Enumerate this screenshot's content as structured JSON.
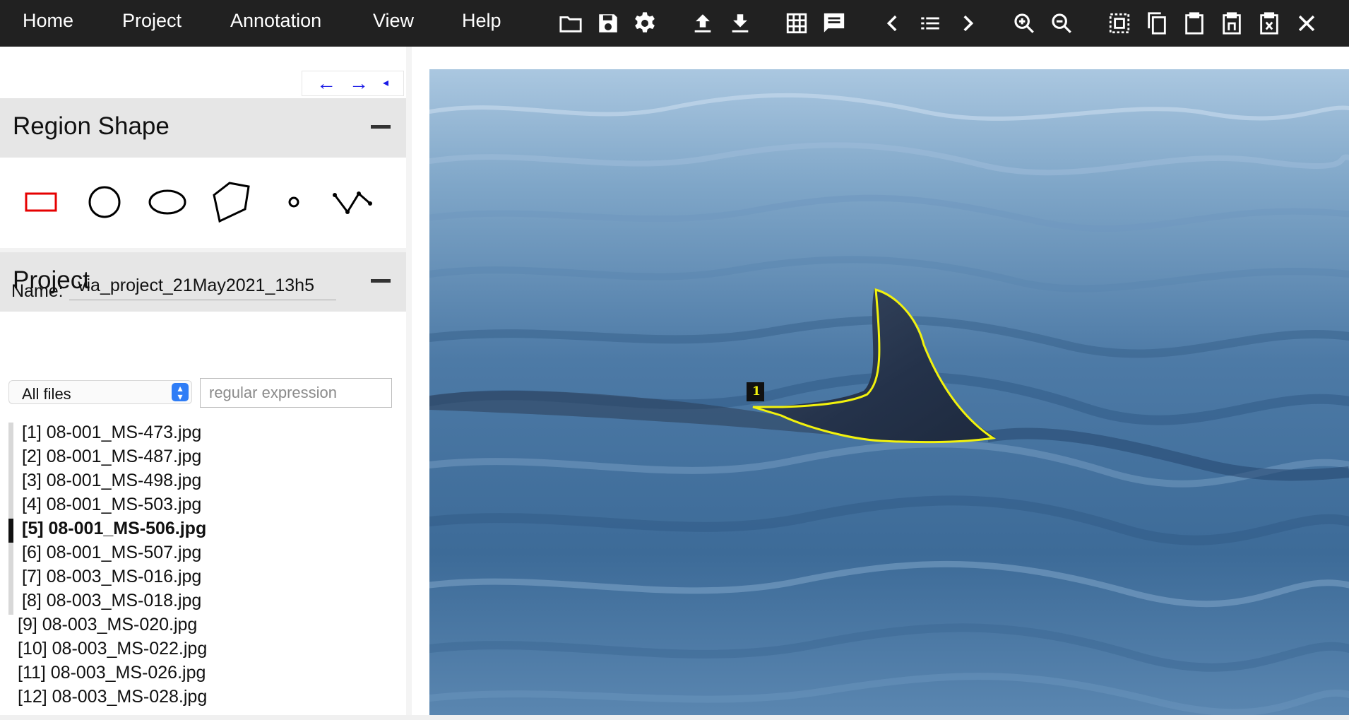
{
  "menu": {
    "home": "Home",
    "project": "Project",
    "annotation": "Annotation",
    "view": "View",
    "help": "Help"
  },
  "toolbar_icons": [
    "folder-open-icon",
    "save-icon",
    "settings-icon",
    "upload-icon",
    "download-icon",
    "grid-view-icon",
    "comment-icon",
    "previous-icon",
    "list-icon",
    "next-icon",
    "zoom-in-icon",
    "zoom-out-icon",
    "select-all-icon",
    "copy-icon",
    "paste-icon",
    "paste-n-icon",
    "paste-x-icon",
    "close-icon"
  ],
  "nav_arrows": {
    "left": "←",
    "right": "→",
    "collapse": "◂"
  },
  "region_shape": {
    "title": "Region Shape",
    "shapes": [
      "rectangle",
      "circle",
      "ellipse",
      "polygon",
      "point",
      "polyline"
    ],
    "active_shape": "rectangle"
  },
  "project": {
    "title": "Project",
    "name_label": "Name:",
    "name_value": "via_project_21May2021_13h5",
    "filter_selected": "All files",
    "regex_placeholder": "regular expression",
    "files": [
      "[1] 08-001_MS-473.jpg",
      "[2] 08-001_MS-487.jpg",
      "[3] 08-001_MS-498.jpg",
      "[4] 08-001_MS-503.jpg",
      "[5] 08-001_MS-506.jpg",
      "[6] 08-001_MS-507.jpg",
      "[7] 08-003_MS-016.jpg",
      "[8] 08-003_MS-018.jpg",
      "[9] 08-003_MS-020.jpg",
      "[10] 08-003_MS-022.jpg",
      "[11] 08-003_MS-026.jpg",
      "[12] 08-003_MS-028.jpg"
    ],
    "active_file_index": 4
  },
  "canvas": {
    "region_label": "1",
    "region_color": "#f2f20d",
    "shape_active_color": "#e60000"
  }
}
